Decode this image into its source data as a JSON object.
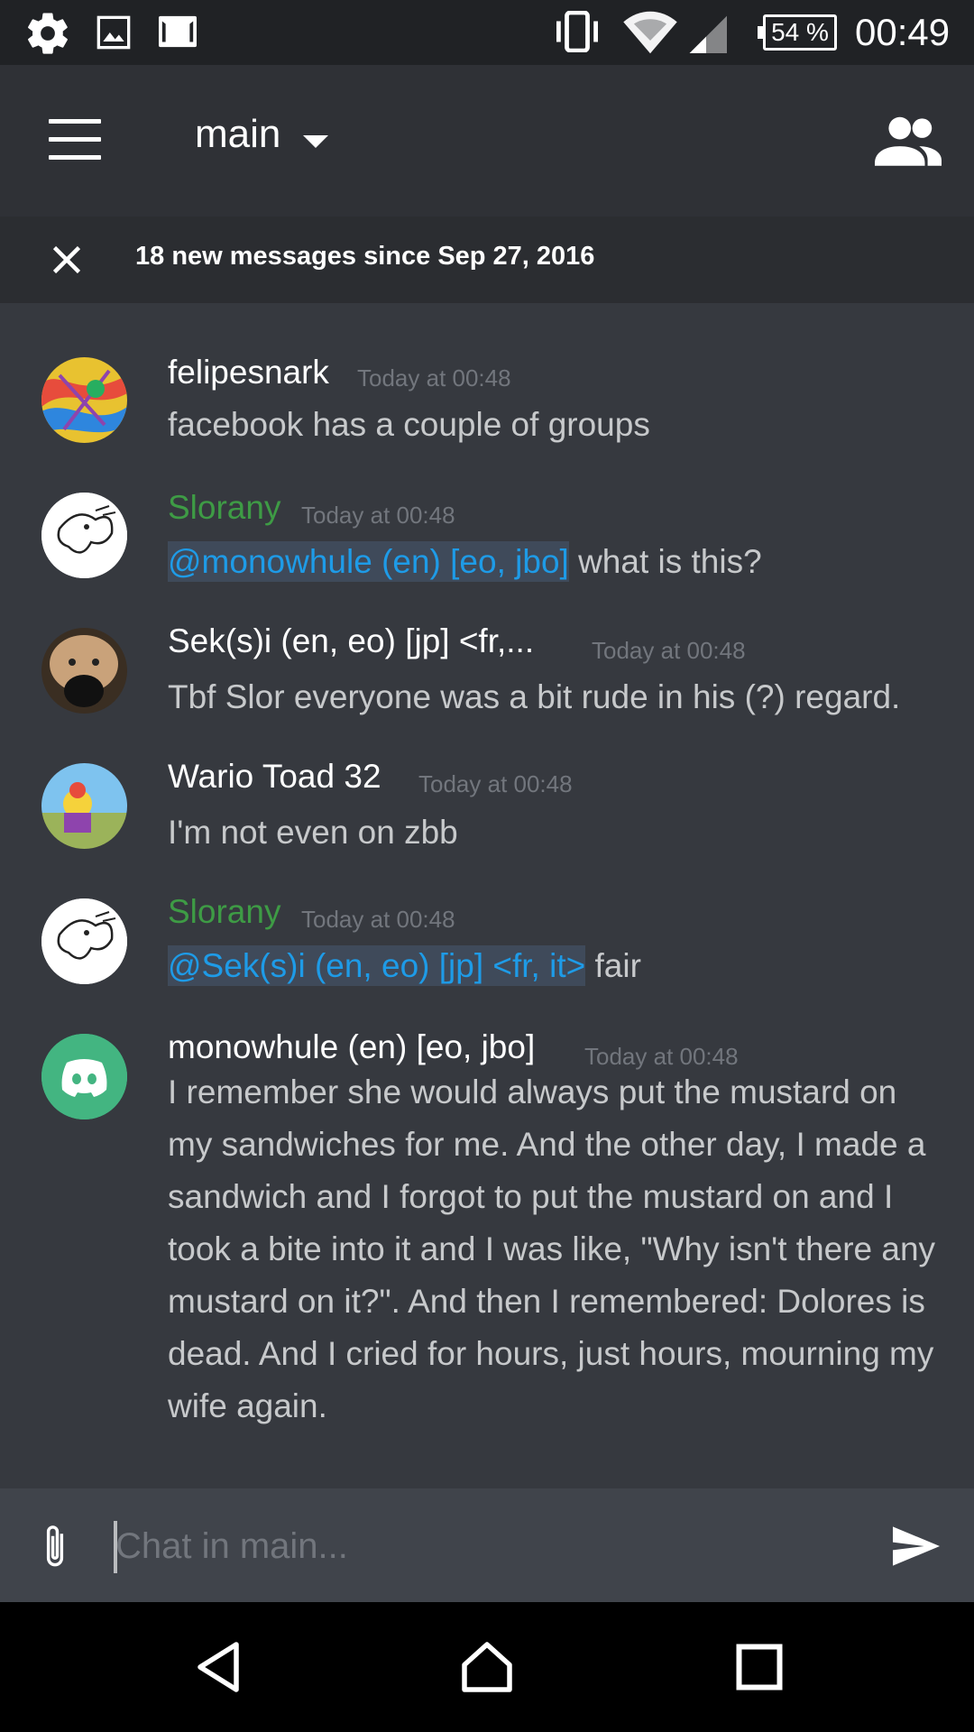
{
  "status_bar": {
    "battery": "54 %",
    "time": "00:49",
    "left_icons": [
      "settings-icon",
      "image-icon",
      "gmail-icon"
    ],
    "right_icons": [
      "vibrate-icon",
      "wifi-icon",
      "signal-icon",
      "battery-icon"
    ]
  },
  "header": {
    "channel": "main",
    "menu_icon": "hamburger-icon",
    "members_icon": "members-icon"
  },
  "new_messages": {
    "text": "18 new messages since Sep 27, 2016"
  },
  "messages": [
    {
      "user": "felipesnark",
      "time": "Today at 00:48",
      "text": "facebook has a couple of groups"
    },
    {
      "user": "Slorany",
      "time": "Today at 00:48",
      "mention": "@monowhule (en) [eo, jbo]",
      "text": " what is this?",
      "user_color": "#3e9b45"
    },
    {
      "user": "Sek(s)i (en, eo) [jp] <fr,...",
      "time": "Today at 00:48",
      "text": "Tbf Slor everyone was a bit rude in his (?) regard."
    },
    {
      "user": "Wario Toad 32",
      "time": "Today at 00:48",
      "text": "I'm not even on zbb"
    },
    {
      "user": "Slorany",
      "time": "Today at 00:48",
      "mention": "@Sek(s)i (en, eo) [jp] <fr, it>",
      "text": " fair",
      "user_color": "#3e9b45"
    },
    {
      "user": "monowhule (en) [eo, jbo]",
      "time": "Today at 00:48",
      "text": "I remember she would always put the mustard on my sandwiches for me. And the other day, I made a sandwich and I forgot to put the mustard on and I took a bite into it and I was like, \"Why isn't there any mustard on it?\". And then I remembered: Dolores is dead. And I cried for hours, just hours, mourning my wife again."
    }
  ],
  "input": {
    "placeholder": "Chat in main..."
  },
  "colors": {
    "background": "#36393f",
    "header": "#2f3136",
    "mention": "#1e9be7",
    "mention_bg": "#3f4a5a",
    "timestamp": "#72767d",
    "discord_green": "#43b581"
  }
}
